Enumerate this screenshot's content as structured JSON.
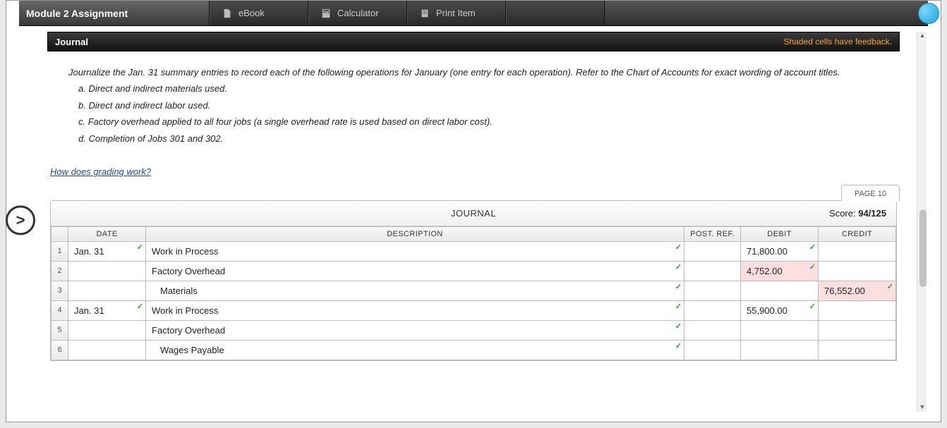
{
  "header": {
    "title": "Module 2 Assignment",
    "buttons": {
      "ebook": "eBook",
      "calculator": "Calculator",
      "print": "Print Item"
    }
  },
  "panel": {
    "title": "Journal",
    "feedback_note": "Shaded cells have feedback."
  },
  "instructions": {
    "intro": "Journalize the Jan. 31 summary entries to record each of the following operations for January (one entry for each operation). Refer to the Chart of Accounts for exact wording of account titles.",
    "a": "a. Direct and indirect materials used.",
    "b": "b. Direct and indirect labor used.",
    "c": "c. Factory overhead applied to all four jobs (a single overhead rate is used based on direct labor cost).",
    "d": "d. Completion of Jobs 301 and 302."
  },
  "grading_link": "How does grading work?",
  "journal": {
    "page_tab": "PAGE 10",
    "title": "JOURNAL",
    "score_label": "Score:",
    "score_value": "94/125",
    "columns": {
      "date": "DATE",
      "description": "DESCRIPTION",
      "postref": "POST. REF.",
      "debit": "DEBIT",
      "credit": "CREDIT"
    },
    "rows": [
      {
        "n": "1",
        "date": "Jan. 31",
        "desc": "Work in Process",
        "debit": "71,800.00",
        "credit": "",
        "indent": 0,
        "shaded_debit": false,
        "shaded_credit": false
      },
      {
        "n": "2",
        "date": "",
        "desc": "Factory Overhead",
        "debit": "4,752.00",
        "credit": "",
        "indent": 0,
        "shaded_debit": true,
        "shaded_credit": false
      },
      {
        "n": "3",
        "date": "",
        "desc": "Materials",
        "debit": "",
        "credit": "76,552.00",
        "indent": 1,
        "shaded_debit": false,
        "shaded_credit": true
      },
      {
        "n": "4",
        "date": "Jan. 31",
        "desc": "Work in Process",
        "debit": "55,900.00",
        "credit": "",
        "indent": 0,
        "shaded_debit": false,
        "shaded_credit": false
      },
      {
        "n": "5",
        "date": "",
        "desc": "Factory Overhead",
        "debit": "",
        "credit": "",
        "indent": 0,
        "shaded_debit": false,
        "shaded_credit": false
      },
      {
        "n": "6",
        "date": "",
        "desc": "Wages Payable",
        "debit": "",
        "credit": "",
        "indent": 1,
        "shaded_debit": false,
        "shaded_credit": false
      }
    ]
  },
  "nav_prev": ">"
}
